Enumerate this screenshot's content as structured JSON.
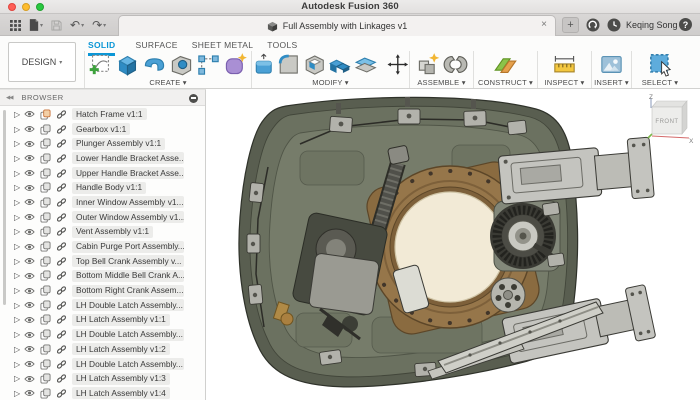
{
  "window": {
    "title": "Autodesk Fusion 360"
  },
  "tab_bar": {
    "document_tab": "Full Assembly with Linkages v1",
    "close_glyph": "×",
    "new_tab_glyph": "+",
    "user_name": "Keqing Song",
    "help_glyph": "?",
    "undo_glyph": "↶",
    "redo_glyph": "↷",
    "caret_glyph": "▾"
  },
  "toolbar": {
    "workspace_label": "DESIGN",
    "caret_glyph": "▾",
    "tabs": [
      {
        "label": "SOLID",
        "active": true
      },
      {
        "label": "SURFACE",
        "active": false
      },
      {
        "label": "SHEET METAL",
        "active": false
      },
      {
        "label": "TOOLS",
        "active": false
      }
    ],
    "groups": [
      {
        "label": "CREATE"
      },
      {
        "label": "MODIFY"
      },
      {
        "label": "ASSEMBLE"
      },
      {
        "label": "CONSTRUCT"
      },
      {
        "label": "INSPECT"
      },
      {
        "label": "INSERT"
      },
      {
        "label": "SELECT"
      }
    ]
  },
  "browser": {
    "panel_title": "BROWSER",
    "collapse_glyph": "◀◀",
    "expand_glyph": "▷",
    "items": [
      {
        "label": "Hatch Frame v1:1",
        "grounded": true
      },
      {
        "label": "Gearbox v1:1"
      },
      {
        "label": "Plunger Assembly v1:1"
      },
      {
        "label": "Lower Handle Bracket Asse..."
      },
      {
        "label": "Upper Handle Bracket Asse..."
      },
      {
        "label": "Handle Body v1:1"
      },
      {
        "label": "Inner Window Assembly v1..."
      },
      {
        "label": "Outer Window Assembly v1..."
      },
      {
        "label": "Vent Assembly v1:1"
      },
      {
        "label": "Cabin Purge Port Assembly..."
      },
      {
        "label": "Top Bell Crank Assembly v..."
      },
      {
        "label": "Bottom Middle Bell Crank A..."
      },
      {
        "label": "Bottom Right Crank Assem..."
      },
      {
        "label": "LH Double Latch Assembly..."
      },
      {
        "label": "LH Latch Assembly v1:1"
      },
      {
        "label": "LH Double Latch Assembly..."
      },
      {
        "label": "LH Latch Assembly v1:2"
      },
      {
        "label": "LH Double Latch Assembly..."
      },
      {
        "label": "LH Latch Assembly v1:3"
      },
      {
        "label": "LH Latch Assembly v1:4"
      }
    ]
  },
  "viewport": {
    "viewcube_front": "FRONT",
    "axis_z": "Z",
    "axis_x": "X"
  },
  "colors": {
    "accent_blue": "#0a96d6",
    "hatch_olive": "#6e7463",
    "flange_bronze": "#96764a",
    "window_cream": "#f2ead6"
  }
}
